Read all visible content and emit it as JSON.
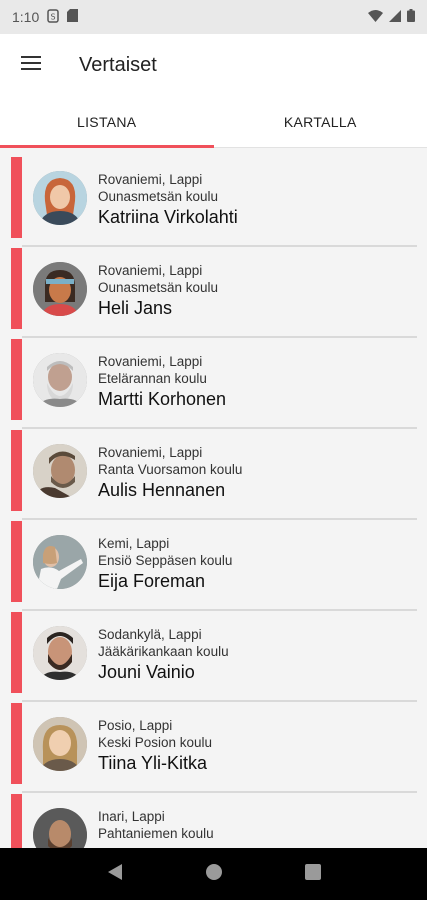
{
  "status_bar": {
    "time": "1:10"
  },
  "app_bar": {
    "title": "Vertaiset"
  },
  "tabs": [
    {
      "label": "LISTANA",
      "active": true
    },
    {
      "label": "KARTALLA",
      "active": false
    }
  ],
  "accent_color": "#f0505a",
  "peers": [
    {
      "location": "Rovaniemi, Lappi",
      "school": "Ounasmetsän koulu",
      "name": "Katriina Virkolahti"
    },
    {
      "location": "Rovaniemi, Lappi",
      "school": "Ounasmetsän koulu",
      "name": "Heli Jans"
    },
    {
      "location": "Rovaniemi, Lappi",
      "school": "Etelärannan koulu",
      "name": "Martti Korhonen"
    },
    {
      "location": "Rovaniemi, Lappi",
      "school": "Ranta Vuorsamon koulu",
      "name": "Aulis Hennanen"
    },
    {
      "location": "Kemi, Lappi",
      "school": "Ensiö Seppäsen koulu",
      "name": "Eija Foreman"
    },
    {
      "location": "Sodankylä, Lappi",
      "school": "Jääkärikankaan koulu",
      "name": "Jouni Vainio"
    },
    {
      "location": "Posio, Lappi",
      "school": "Keski Posion koulu",
      "name": "Tiina Yli-Kitka"
    },
    {
      "location": "Inari, Lappi",
      "school": "Pahtaniemen koulu",
      "name": ""
    }
  ]
}
